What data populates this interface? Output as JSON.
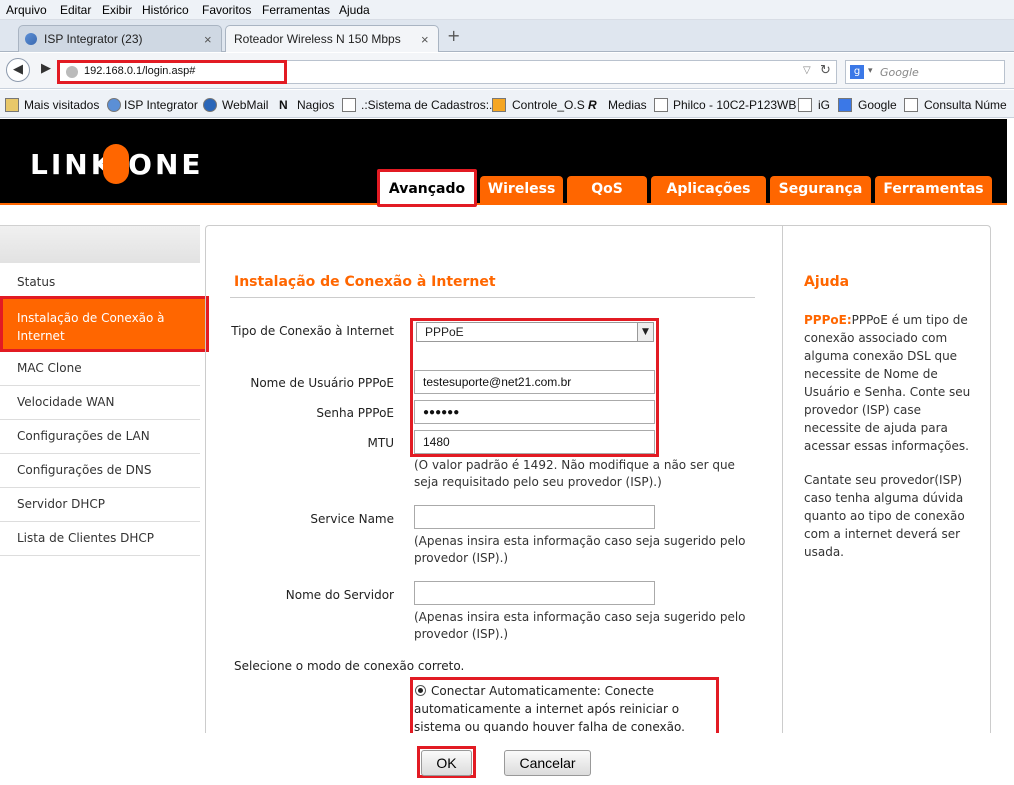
{
  "browser": {
    "menu": [
      "Arquivo",
      "Editar",
      "Exibir",
      "Histórico",
      "Favoritos",
      "Ferramentas",
      "Ajuda"
    ],
    "tabs": [
      {
        "label": "ISP Integrator (23)"
      },
      {
        "label": "Roteador Wireless N 150 Mbps"
      }
    ],
    "new_tab": "+",
    "close_glyph": "×",
    "url": "192.168.0.1/login.asp#",
    "search_placeholder": "Google",
    "bookmarks": [
      "Mais visitados",
      "ISP Integrator",
      "WebMail",
      "Nagios",
      ".:Sistema de Cadastros:.",
      "Controle_O.S",
      "Medias",
      "Philco - 10C2-P123WB",
      "iG",
      "Google",
      "Consulta Núme"
    ]
  },
  "router": {
    "logo": "LINK ONE",
    "tabs": [
      "Avançado",
      "Wireless",
      "QoS",
      "Aplicações",
      "Segurança",
      "Ferramentas"
    ],
    "active_tab": "Avançado"
  },
  "sidebar": {
    "items": [
      "Status",
      "Instalação de Conexão à Internet",
      "MAC Clone",
      "Velocidade WAN",
      "Configurações de LAN",
      "Configurações de DNS",
      "Servidor DHCP",
      "Lista de Clientes DHCP"
    ],
    "active": "Instalação de Conexão à Internet"
  },
  "main": {
    "title": "Instalação de Conexão à Internet",
    "connection_type_label": "Tipo de Conexão à Internet",
    "connection_type_value": "PPPoE",
    "username_label": "Nome de Usuário PPPoE",
    "username_value": "testesuporte@net21.com.br",
    "password_label": "Senha PPPoE",
    "password_value": "●●●●●●",
    "mtu_label": "MTU",
    "mtu_value": "1480",
    "mtu_note": "(O valor padrão é 1492. Não modifique a não ser que seja requisitado pelo seu provedor (ISP).)",
    "service_label": "Service Name",
    "service_value": "",
    "service_note": "(Apenas insira esta informação caso seja sugerido pelo provedor (ISP).)",
    "server_label": "Nome do Servidor",
    "server_value": "",
    "server_note": "(Apenas insira esta informação caso seja sugerido pelo provedor (ISP).)",
    "mode_label": "Selecione o modo de conexão correto.",
    "mode_option": "Conectar Automaticamente: Conecte automaticamente a internet após reiniciar o sistema ou quando houver falha de conexão.",
    "ok_label": "OK",
    "cancel_label": "Cancelar"
  },
  "help": {
    "title": "Ajuda",
    "p1_term": "PPPoE:",
    "p1_text": "PPPoE é um tipo de conexão associado com alguma conexão DSL que necessite de Nome de Usuário e Senha. Conte seu provedor (ISP) case necessite de ajuda para acessar essas informações.",
    "p2_text": "Cantate seu provedor(ISP) caso tenha alguma dúvida quanto ao tipo de conexão com a internet deverá ser usada."
  },
  "colors": {
    "accent": "#ff6600",
    "highlight_box": "#e21b23",
    "header_bg": "#000000"
  }
}
